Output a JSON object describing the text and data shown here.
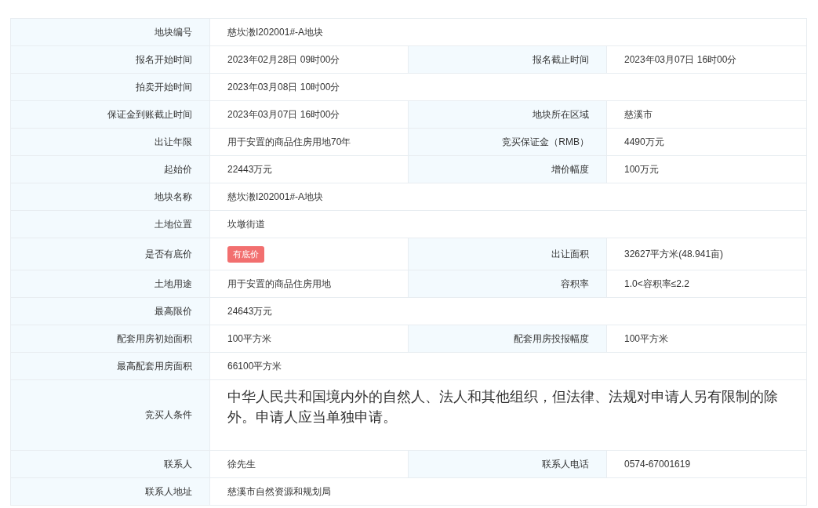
{
  "rows": [
    {
      "fields": [
        {
          "label": "地块编号",
          "value": "慈坎漖I202001#-A地块",
          "kind": "text"
        }
      ]
    },
    {
      "fields": [
        {
          "label": "报名开始时间",
          "value": "2023年02月28日 09时00分",
          "kind": "text"
        },
        {
          "label": "报名截止时间",
          "value": "2023年03月07日 16时00分",
          "kind": "text"
        }
      ]
    },
    {
      "fields": [
        {
          "label": "拍卖开始时间",
          "value": "2023年03月08日 10时00分",
          "kind": "text"
        }
      ]
    },
    {
      "fields": [
        {
          "label": "保证金到账截止时间",
          "value": "2023年03月07日 16时00分",
          "kind": "text"
        },
        {
          "label": "地块所在区域",
          "value": "慈溪市",
          "kind": "text"
        }
      ]
    },
    {
      "fields": [
        {
          "label": "出让年限",
          "value": "用于安置的商品住房用地70年",
          "kind": "text"
        },
        {
          "label": "竞买保证金（RMB）",
          "value": "4490万元",
          "kind": "text"
        }
      ]
    },
    {
      "fields": [
        {
          "label": "起始价",
          "value": "22443万元",
          "kind": "text"
        },
        {
          "label": "增价幅度",
          "value": "100万元",
          "kind": "text"
        }
      ]
    },
    {
      "fields": [
        {
          "label": "地块名称",
          "value": "慈坎漖I202001#-A地块",
          "kind": "text"
        }
      ]
    },
    {
      "fields": [
        {
          "label": "土地位置",
          "value": "坎墩街道",
          "kind": "text"
        }
      ]
    },
    {
      "fields": [
        {
          "label": "是否有底价",
          "value": "有底价",
          "kind": "badge"
        },
        {
          "label": "出让面积",
          "value": "32627平方米(48.941亩)",
          "kind": "text"
        }
      ]
    },
    {
      "fields": [
        {
          "label": "土地用途",
          "value": "用于安置的商品住房用地",
          "kind": "text"
        },
        {
          "label": "容积率",
          "value": "1.0<容积率≤2.2",
          "kind": "text"
        }
      ]
    },
    {
      "fields": [
        {
          "label": "最高限价",
          "value": "24643万元",
          "kind": "text"
        }
      ]
    },
    {
      "fields": [
        {
          "label": "配套用房初始面积",
          "value": "100平方米",
          "kind": "text"
        },
        {
          "label": "配套用房投报幅度",
          "value": "100平方米",
          "kind": "text"
        }
      ]
    },
    {
      "fields": [
        {
          "label": "最高配套用房面积",
          "value": "66100平方米",
          "kind": "text"
        }
      ]
    },
    {
      "fields": [
        {
          "label": "竞买人条件",
          "value": "中华人民共和国境内外的自然人、法人和其他组织，但法律、法规对申请人另有限制的除外。申请人应当单独申请。",
          "kind": "long"
        }
      ]
    },
    {
      "fields": [
        {
          "label": "联系人",
          "value": "徐先生",
          "kind": "text"
        },
        {
          "label": "联系人电话",
          "value": "0574-67001619",
          "kind": "text"
        }
      ]
    },
    {
      "fields": [
        {
          "label": "联系人地址",
          "value": "慈溪市自然资源和规划局",
          "kind": "text"
        }
      ]
    }
  ]
}
